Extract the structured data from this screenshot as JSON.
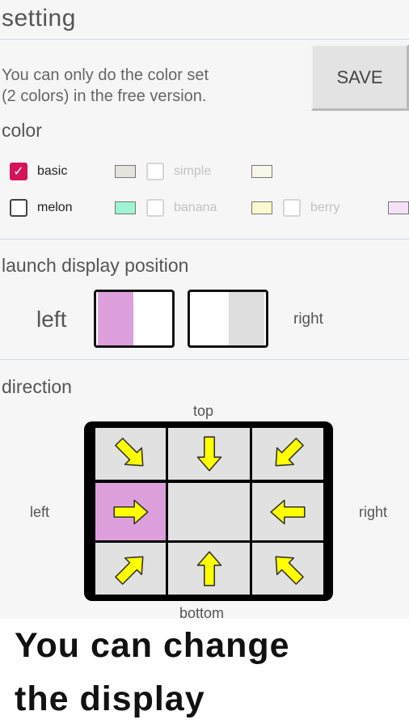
{
  "header": {
    "title": "setting"
  },
  "info": {
    "line1": "You can only do the color set",
    "line2": "(2 colors) in the free version."
  },
  "save_button": {
    "label": "SAVE"
  },
  "color": {
    "section_label": "color",
    "options": [
      {
        "label": "basic",
        "checked": true,
        "enabled": true,
        "swatch": "#e4e4dc"
      },
      {
        "label": "simple",
        "checked": false,
        "enabled": false,
        "swatch": "#f9f7e8"
      },
      {
        "label": "melon",
        "checked": false,
        "enabled": true,
        "swatch": "#9ef5d2"
      },
      {
        "label": "banana",
        "checked": false,
        "enabled": false,
        "swatch": "#fbf9cf"
      },
      {
        "label": "berry",
        "checked": false,
        "enabled": false,
        "swatch": "#f6e0f8"
      }
    ]
  },
  "launch": {
    "section_label": "launch display position",
    "left_label": "left",
    "right_label": "right",
    "selected": "left"
  },
  "direction": {
    "section_label": "direction",
    "top_label": "top",
    "bottom_label": "bottom",
    "left_label": "left",
    "right_label": "right",
    "selected_cell": "middle-left"
  },
  "caption": {
    "line1": "You can change",
    "line2": "the display"
  },
  "colors": {
    "accent": "#d4145a",
    "selected_fill": "#dda0dd",
    "arrow": "#ffff00",
    "cell_bg": "#e1e1e1"
  }
}
